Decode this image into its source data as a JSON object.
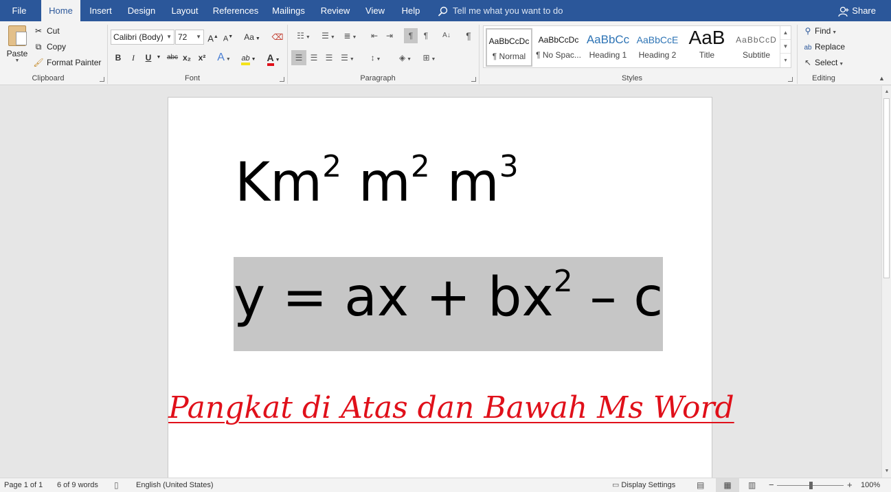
{
  "tabs": [
    {
      "label": "File",
      "active": false
    },
    {
      "label": "Home",
      "active": true
    },
    {
      "label": "Insert",
      "active": false
    },
    {
      "label": "Design",
      "active": false
    },
    {
      "label": "Layout",
      "active": false
    },
    {
      "label": "References",
      "active": false
    },
    {
      "label": "Mailings",
      "active": false
    },
    {
      "label": "Review",
      "active": false
    },
    {
      "label": "View",
      "active": false
    },
    {
      "label": "Help",
      "active": false
    }
  ],
  "tell_me": "Tell me what you want to do",
  "share": "Share",
  "clipboard": {
    "paste": "Paste",
    "cut": "Cut",
    "copy": "Copy",
    "format_painter": "Format Painter",
    "label": "Clipboard"
  },
  "font": {
    "name": "Calibri (Body)",
    "size": "72",
    "label": "Font",
    "bold": "B",
    "italic": "I",
    "underline": "U",
    "strike": "abc",
    "sub": "x₂",
    "sup": "x²",
    "grow": "A",
    "shrink": "A",
    "change_case": "Aa",
    "effects": "A",
    "highlight": "ab",
    "color": "A"
  },
  "paragraph": {
    "label": "Paragraph",
    "show_marks": "¶"
  },
  "styles": {
    "label": "Styles",
    "items": [
      {
        "preview": "AaBbCcDc",
        "name": "¶ Normal"
      },
      {
        "preview": "AaBbCcDc",
        "name": "¶ No Spac..."
      },
      {
        "preview": "AaBbCc",
        "name": "Heading 1"
      },
      {
        "preview": "AaBbCcE",
        "name": "Heading 2"
      },
      {
        "preview": "AaB",
        "name": "Title"
      },
      {
        "preview": "AaBbCcD",
        "name": "Subtitle"
      }
    ]
  },
  "editing": {
    "label": "Editing",
    "find": "Find",
    "replace": "Replace",
    "select": "Select"
  },
  "document": {
    "line1": {
      "p1": "Km",
      "s1": "2",
      "p2": " m",
      "s2": "2",
      "p3": " m",
      "s3": "3"
    },
    "line2": {
      "p1": "y = ax + bx",
      "s1": "2",
      "p2": " – c"
    },
    "caption": "Pangkat di Atas dan Bawah Ms Word"
  },
  "status": {
    "page": "Page 1 of 1",
    "words": "6 of 9 words",
    "language": "English (United States)",
    "display_settings": "Display Settings",
    "zoom": "100%"
  },
  "colors": {
    "brand": "#2b579a",
    "caption": "#e0101a",
    "selection": "#c6c6c6"
  }
}
